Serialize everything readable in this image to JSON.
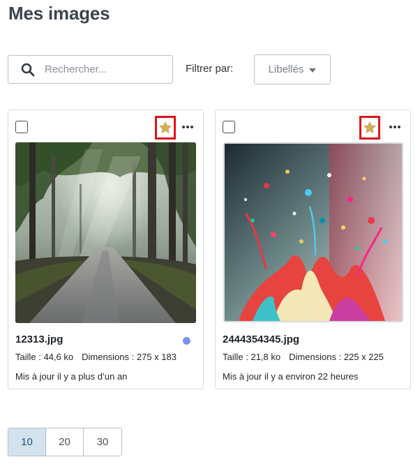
{
  "page": {
    "title": "Mes images"
  },
  "search": {
    "placeholder": "Rechercher..."
  },
  "filter": {
    "label": "Filtrer par:",
    "selected": "Libellés"
  },
  "images": [
    {
      "filename": "12313.jpg",
      "size": "Taille : 44,6 ko",
      "dimensions": "Dimensions : 275 x 183",
      "updated": "Mis à jour il y a plus d’un an",
      "starred": true,
      "status_color": "#7f8ef2"
    },
    {
      "filename": "2444354345.jpg",
      "size": "Taille : 21,8 ko",
      "dimensions": "Dimensions : 225 x 225",
      "updated": "Mis à jour il y a environ 22 heures",
      "starred": true
    }
  ],
  "pagination": {
    "options": [
      "10",
      "20",
      "30"
    ],
    "selected": "10"
  },
  "colors": {
    "star": "#d4b054",
    "highlight": "#e0141c",
    "pager_active": "#d2e3ee"
  }
}
